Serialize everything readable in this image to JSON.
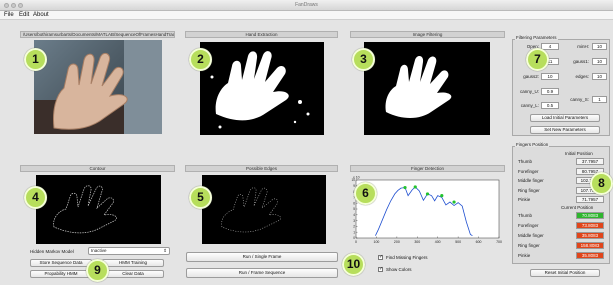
{
  "window": {
    "title": "FanDraws"
  },
  "menu": [
    "File",
    "Edit",
    "About"
  ],
  "panels": {
    "source_path": "/Users/bothiramsurbarts/Documents/MATLAB/SequenceOfFramesHandTracking/frame0001.jpg",
    "hand_extraction": "Hand Extraction",
    "image_filtering": "Image Filtering",
    "contour": "Contour",
    "possible_edges": "Possible Edges",
    "finger_detection": "Finger Detection"
  },
  "badges": [
    "1",
    "2",
    "3",
    "4",
    "5",
    "6",
    "7",
    "8",
    "9",
    "10"
  ],
  "filtering": {
    "title": "Filtering Parameters",
    "fields": [
      {
        "label": "Open:",
        "value": "4"
      },
      {
        "label": "minH:",
        "value": "10"
      },
      {
        "label": "minB:",
        "value": "11"
      },
      {
        "label": "gauss1:",
        "value": "10"
      },
      {
        "label": "gauss2:",
        "value": "10"
      },
      {
        "label": "edges:",
        "value": "10"
      },
      {
        "label": "canny_U:",
        "value": "0.9"
      },
      {
        "label": "canny_S:",
        "value": "1"
      },
      {
        "label": "canny_L:",
        "value": "0.5"
      }
    ],
    "load_button": "Load Initial Parameters",
    "set_button": "Set New Parameters"
  },
  "fingers": {
    "title": "Fingers Position",
    "initial_header": "Initial Position",
    "current_header": "Current Position",
    "names": [
      "Thumb",
      "Forefinger",
      "Middle finger",
      "Ring finger",
      "Pinkie"
    ],
    "initial": [
      "37.7957",
      "80.7957",
      "102.7957",
      "107.7957",
      "71.7957"
    ],
    "current": [
      "70.8083",
      "73.8083",
      "35.8083",
      "158.8083",
      "35.8083"
    ],
    "current_colors": [
      "#2eb52e",
      "#e0441a",
      "#e0441a",
      "#e0441a",
      "#e0441a"
    ],
    "reset_button": "Reset Initial Position"
  },
  "controls": {
    "hmm_label": "Hidden Markov Model",
    "hmm_value": "Inactive",
    "store_seq": "Store Sequence Data",
    "hmm_training": "HMM Training",
    "propability_hmm": "Propability HMM",
    "clear_data": "Clear Data",
    "run_single": "Run / Single Frame",
    "run_sequence": "Run / Frame Sequence",
    "find_missing": "Find Missing Fingers",
    "show_colors": "Show Colors"
  },
  "chart_data": {
    "type": "line",
    "title": "",
    "xlabel": "",
    "ylabel": "",
    "xlim": [
      0,
      700
    ],
    "ylim": [
      0,
      10
    ],
    "x_ticks": [
      "0",
      "100",
      "200",
      "300",
      "400",
      "500",
      "600",
      "700"
    ],
    "y_ticks": [
      "0",
      "1",
      "2",
      "3",
      "4",
      "5",
      "6",
      "7",
      "8",
      "9",
      "10"
    ],
    "y_exponent_label": "x 10",
    "series": [
      {
        "color": "#1f4fd0",
        "x": [
          95,
          110,
          130,
          150,
          170,
          190,
          205,
          220,
          240,
          255,
          275,
          290,
          310,
          330,
          350,
          370,
          385,
          400,
          420,
          440,
          460,
          480,
          500,
          520,
          540,
          560,
          570
        ],
        "y": [
          0.4,
          1.5,
          3.2,
          4.9,
          6.4,
          7.6,
          8.2,
          8.6,
          8.7,
          7.3,
          8.3,
          8.8,
          8.1,
          6.5,
          7.6,
          7.3,
          6.4,
          7.3,
          7.0,
          5.7,
          6.2,
          5.6,
          6.1,
          5.5,
          2.8,
          0.6,
          0.4
        ]
      }
    ],
    "markers": {
      "color": "#22c22e",
      "x": [
        240,
        290,
        350,
        420,
        480
      ],
      "y": [
        8.7,
        8.8,
        7.6,
        7.3,
        6.2
      ]
    }
  }
}
